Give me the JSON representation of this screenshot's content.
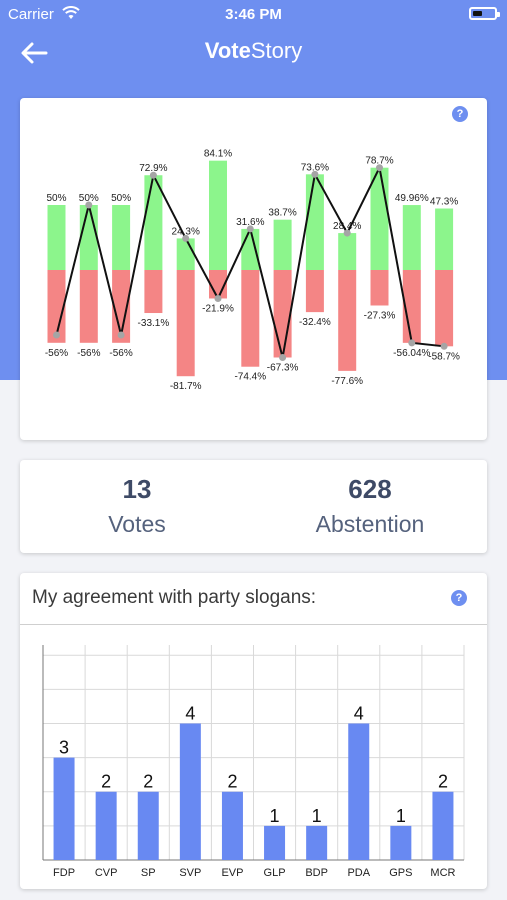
{
  "status_bar": {
    "carrier": "Carrier",
    "time": "3:46 PM"
  },
  "nav": {
    "title_bold": "Vote",
    "title_regular": "Story",
    "back_icon": "arrow-left-icon"
  },
  "colors": {
    "accent": "#6e8ff0",
    "positive": "#8cf58c",
    "negative": "#f48585",
    "bar": "#6889f2",
    "line": "#111111",
    "point": "#a5a5a5"
  },
  "vote_chart": {
    "help_label": "?",
    "chart_data": {
      "type": "bar",
      "series": [
        {
          "values": [
            50,
            50,
            50,
            72.9,
            24.3,
            84.1,
            31.6,
            38.7,
            73.6,
            28.4,
            78.7,
            49.96,
            47.3
          ],
          "labels": [
            "50%",
            "50%",
            "50%",
            "72.9%",
            "24.3%",
            "84.1%",
            "31.6%",
            "38.7%",
            "73.6%",
            "28.4%",
            "78.7%",
            "49.96%",
            "47.3%"
          ]
        },
        {
          "values": [
            -56,
            -56,
            -56,
            -33.1,
            -81.7,
            -21.9,
            -74.4,
            -67.3,
            -32.4,
            -77.6,
            -27.3,
            -56.04,
            -58.7
          ],
          "labels": [
            "-56%",
            "-56%",
            "-56%",
            "-33.1%",
            "-81.7%",
            "-21.9%",
            "-74.4%",
            "-67.3%",
            "-32.4%",
            "-77.6%",
            "-27.3%",
            "-56.04%",
            "-58.7%"
          ]
        },
        {
          "values": [
            -50,
            50,
            -50,
            72.9,
            24.3,
            -21.9,
            31.6,
            -67.3,
            73.6,
            28.4,
            78.7,
            -56.04,
            -58.7
          ]
        }
      ],
      "ylim": [
        -100,
        100
      ]
    }
  },
  "stats": {
    "votes_value": "13",
    "votes_label": "Votes",
    "abstention_value": "628",
    "abstention_label": "Abstention"
  },
  "slogans": {
    "title": "My agreement with party slogans:",
    "help_label": "?",
    "chart_data": {
      "type": "bar",
      "categories": [
        "FDP",
        "CVP",
        "SP",
        "SVP",
        "EVP",
        "GLP",
        "BDP",
        "PDA",
        "GPS",
        "MCR"
      ],
      "values": [
        3,
        2,
        2,
        4,
        2,
        1,
        1,
        4,
        1,
        2
      ],
      "ylim": [
        0,
        6.3
      ],
      "grid": true
    }
  }
}
